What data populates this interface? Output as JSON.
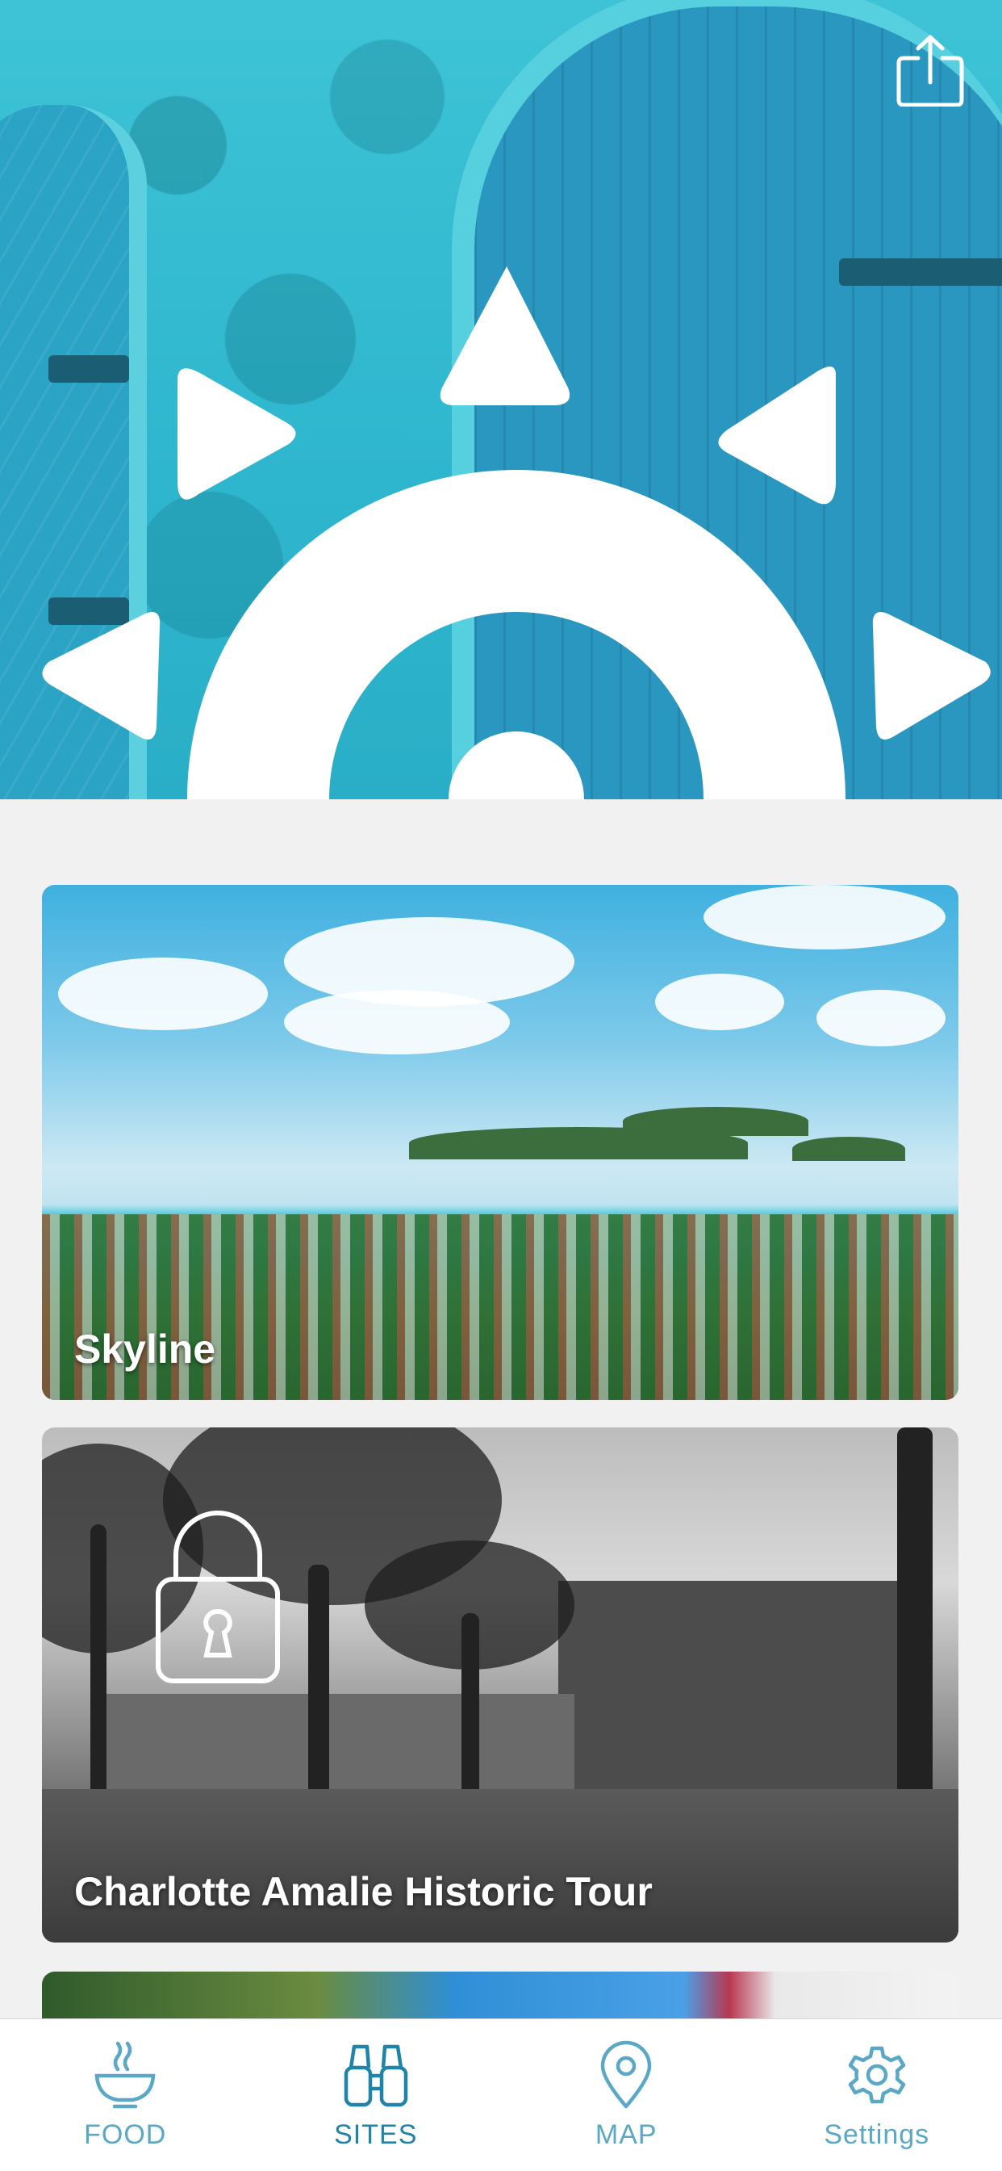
{
  "hero": {
    "share_icon": "share-icon",
    "logo": "sun-logo"
  },
  "cards": [
    {
      "title": "Skyline",
      "locked": false
    },
    {
      "title": "Charlotte Amalie Historic Tour",
      "locked": true,
      "lock_icon": "lock-icon"
    }
  ],
  "tabbar": {
    "active": "SITES",
    "tabs": [
      {
        "label": "FOOD",
        "icon": "bowl-icon"
      },
      {
        "label": "SITES",
        "icon": "binoculars-icon"
      },
      {
        "label": "MAP",
        "icon": "map-pin-icon"
      },
      {
        "label": "Settings",
        "icon": "gear-icon"
      }
    ]
  },
  "colors": {
    "accent": "#1f84a9",
    "tab_inactive": "#5aa8c5",
    "hero_teal": "#2fb7cf",
    "background": "#f1f1f1"
  }
}
